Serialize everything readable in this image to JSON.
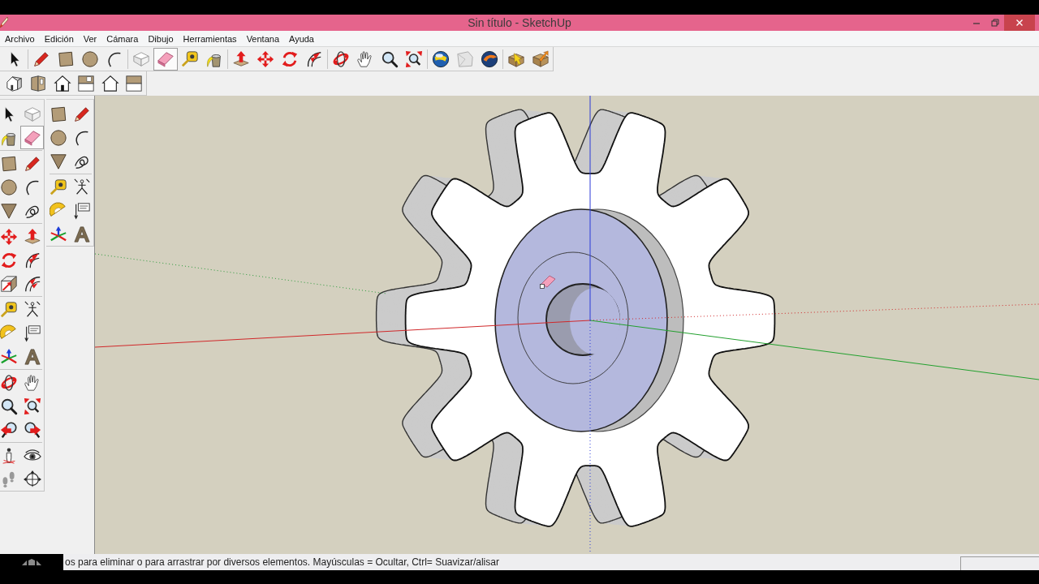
{
  "window": {
    "title": "Sin título - SketchUp"
  },
  "menu_bar": {
    "items": [
      "Archivo",
      "Edición",
      "Ver",
      "Cámara",
      "Dibujo",
      "Herramientas",
      "Ventana",
      "Ayuda"
    ]
  },
  "toolbars": [
    {
      "tools": [
        {
          "selected": false
        },
        {
          "selected": false
        },
        {
          "selected": false
        },
        {
          "selected": false
        },
        {
          "selected": false
        },
        {
          "selected": false
        },
        {
          "selected": true
        },
        {
          "selected": false
        },
        {
          "selected": false
        },
        {
          "selected": false
        },
        {
          "selected": false
        },
        {
          "selected": false
        },
        {
          "selected": false
        },
        {
          "selected": false
        },
        {
          "selected": false
        },
        {
          "selected": false
        },
        {
          "selected": false
        },
        {
          "selected": false
        },
        {
          "selected": false
        },
        {
          "selected": false
        },
        {
          "selected": false
        },
        {
          "selected": false
        }
      ]
    },
    {
      "tools": [
        {
          "selected": false
        },
        {
          "selected": false
        },
        {
          "selected": false
        },
        {
          "selected": false
        },
        {
          "selected": false
        },
        {
          "selected": false
        }
      ]
    }
  ],
  "side_toolbars": [
    {
      "tools": [
        {
          "selected": false
        },
        {
          "selected": false
        },
        {
          "selected": false
        },
        {
          "selected": true
        },
        {
          "selected": false
        },
        {
          "selected": false
        },
        {
          "selected": false
        },
        {
          "selected": false
        },
        {
          "selected": false
        },
        {
          "selected": false
        },
        {
          "selected": false
        },
        {
          "selected": false
        },
        {
          "selected": false
        },
        {
          "selected": false
        },
        {
          "selected": false
        },
        {
          "selected": false
        },
        {
          "selected": false
        },
        {
          "selected": false
        },
        {
          "selected": false
        },
        {
          "selected": false
        },
        {
          "selected": false
        },
        {
          "selected": false
        },
        {
          "selected": false
        },
        {
          "selected": false
        },
        {
          "selected": false
        },
        {
          "selected": false
        },
        {
          "selected": false
        },
        {
          "selected": false
        },
        {
          "selected": false
        },
        {
          "selected": false
        },
        {
          "selected": false
        },
        {
          "selected": false
        }
      ]
    },
    {
      "tools": [
        {
          "selected": false
        },
        {
          "selected": false
        },
        {
          "selected": false
        },
        {
          "selected": false
        },
        {
          "selected": false
        },
        {
          "selected": false
        },
        {
          "selected": false
        },
        {
          "selected": false
        },
        {
          "selected": false
        },
        {
          "selected": false
        },
        {
          "selected": false
        },
        {
          "selected": false
        }
      ]
    }
  ],
  "status_bar": {
    "hint": "os para eliminar o para arrastrar por diversos elementos. Mayúsculas = Ocultar, Ctrl= Suavizar/alisar"
  }
}
